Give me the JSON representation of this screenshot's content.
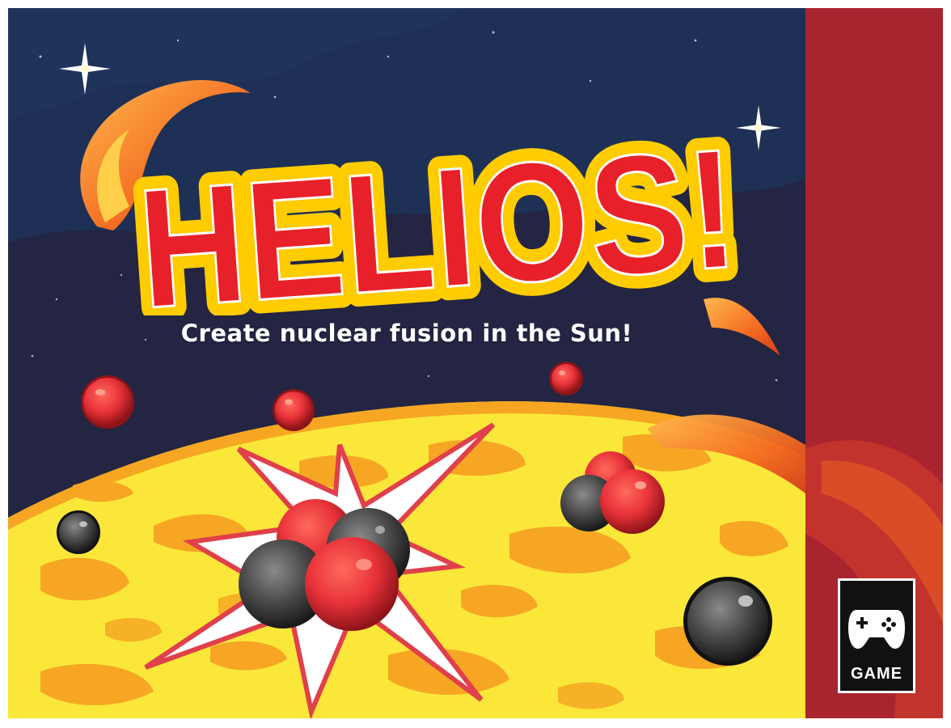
{
  "title": "HELIOS!",
  "subtitle": "Create nuclear fusion in the Sun!",
  "badge": {
    "label": "GAME",
    "icon": "gamepad-icon"
  },
  "colors": {
    "space": "#232542",
    "nebula": "#1e3055",
    "sun_yellow": "#fbe73a",
    "sun_orange": "#f6a623",
    "title_red": "#e8202a",
    "title_outline": "#ffcc00",
    "proton_red": "#e8323a",
    "neutron_gray": "#4a4a4a",
    "side_band": "#a82530"
  }
}
